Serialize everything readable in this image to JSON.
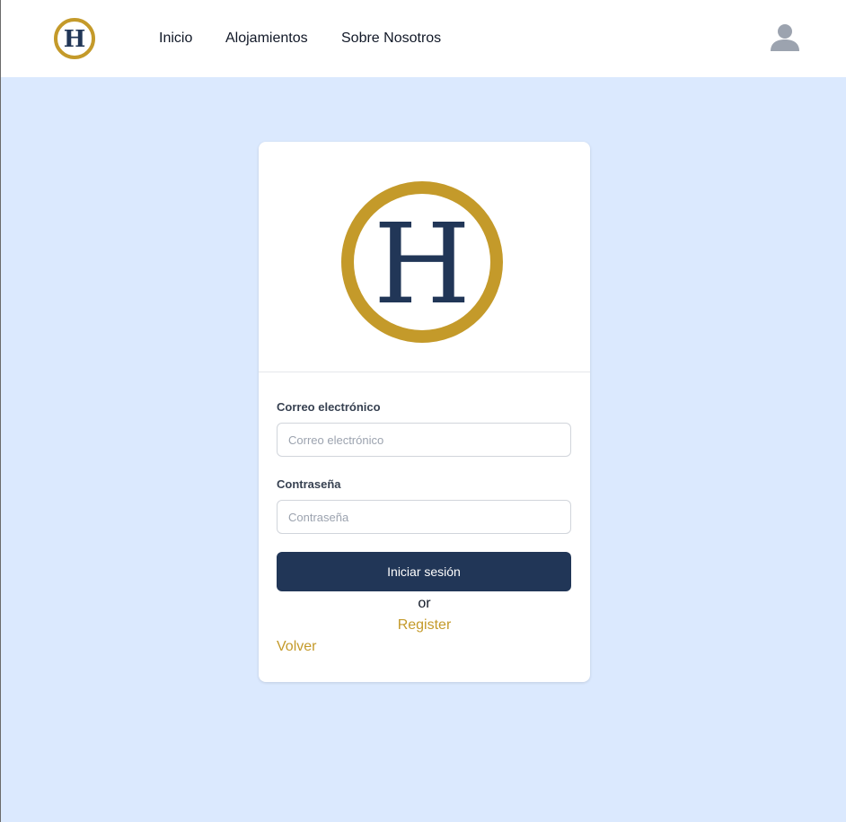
{
  "navbar": {
    "logo_letter": "H",
    "links": [
      "Inicio",
      "Alojamientos",
      "Sobre Nosotros"
    ],
    "user_icon": "user-icon"
  },
  "login": {
    "logo_letter": "H",
    "email_label": "Correo electrónico",
    "email_placeholder": "Correo electrónico",
    "email_value": "",
    "password_label": "Contraseña",
    "password_placeholder": "Contraseña",
    "password_value": "",
    "submit_label": "Iniciar sesión",
    "or_text": "or",
    "register_label": "Register",
    "back_label": "Volver"
  },
  "colors": {
    "background": "#dbe9fe",
    "brand_navy": "#213657",
    "brand_gold": "#c49a2a",
    "card": "#ffffff"
  }
}
